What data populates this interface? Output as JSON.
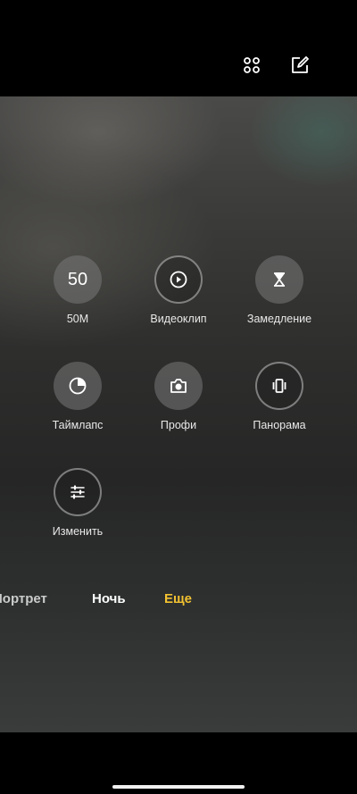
{
  "topbar": {
    "apps_icon": "grid-dots-icon",
    "edit_icon": "edit-icon"
  },
  "modes": [
    {
      "label": "50M",
      "icon_text": "50",
      "icon": "50-text-icon"
    },
    {
      "label": "Видеоклип",
      "icon": "play-icon"
    },
    {
      "label": "Замедление",
      "icon": "hourglass-icon"
    },
    {
      "label": "Таймлапс",
      "icon": "timer-icon"
    },
    {
      "label": "Профи",
      "icon": "camera-icon"
    },
    {
      "label": "Панорама",
      "icon": "panorama-icon"
    },
    {
      "label": "Изменить",
      "icon": "sliders-icon"
    }
  ],
  "mode_tabs": [
    {
      "label": "Портрет",
      "state": "faded"
    },
    {
      "label": "Ночь",
      "state": "normal"
    },
    {
      "label": "Еще",
      "state": "active"
    }
  ],
  "colors": {
    "accent": "#f2c230",
    "text": "#ffffff"
  }
}
